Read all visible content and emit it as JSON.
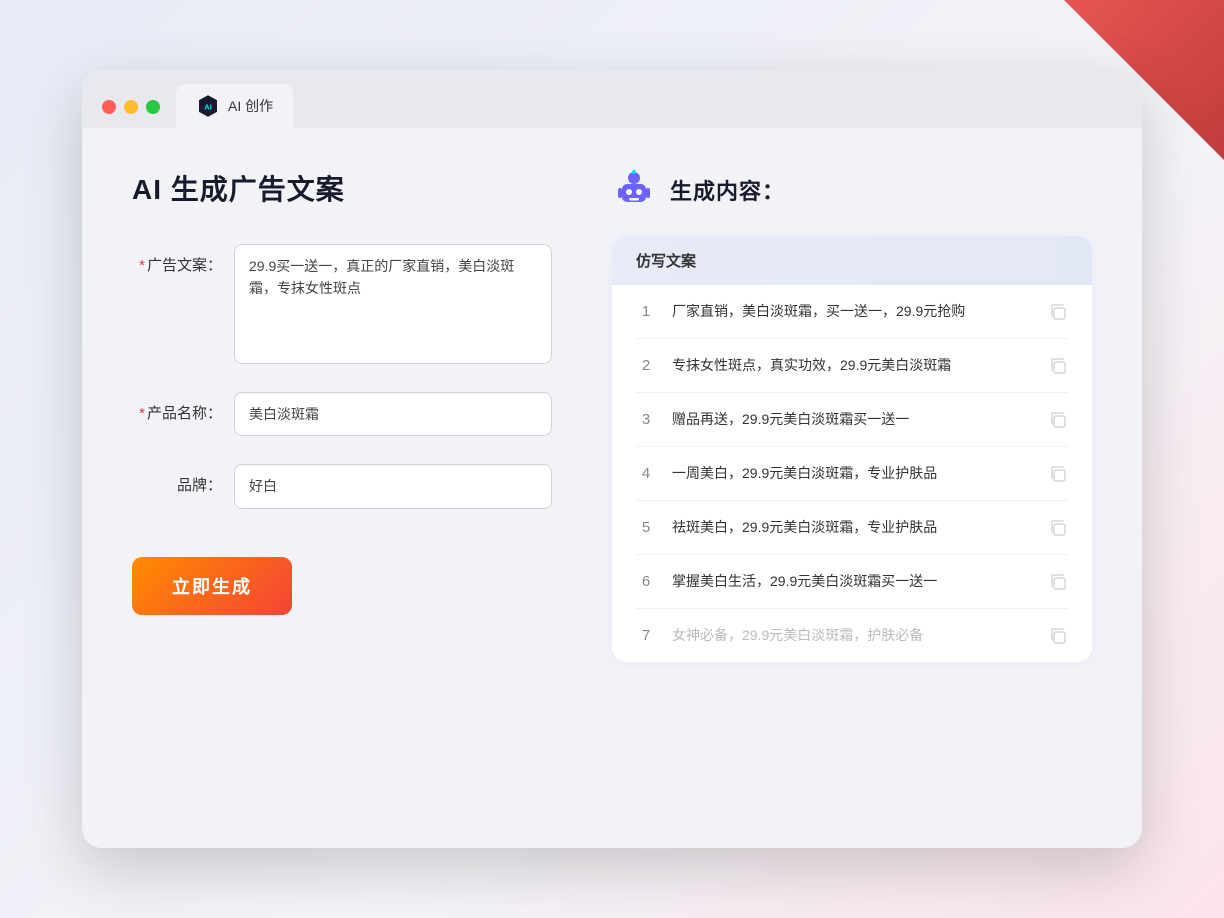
{
  "window": {
    "tab_label": "AI 创作",
    "controls": {
      "close": "close",
      "minimize": "minimize",
      "maximize": "maximize"
    }
  },
  "left_panel": {
    "title": "AI 生成广告文案",
    "form": {
      "ad_copy_label": "广告文案：",
      "ad_copy_required": "*",
      "ad_copy_value": "29.9买一送一，真正的厂家直销，美白淡斑霜，专抹女性斑点",
      "product_name_label": "产品名称：",
      "product_name_required": "*",
      "product_name_value": "美白淡斑霜",
      "brand_label": "品牌：",
      "brand_value": "好白"
    },
    "generate_button": "立即生成"
  },
  "right_panel": {
    "title": "生成内容：",
    "table_header": "仿写文案",
    "results": [
      {
        "num": "1",
        "text": "厂家直销，美白淡斑霜，买一送一，29.9元抢购",
        "dimmed": false
      },
      {
        "num": "2",
        "text": "专抹女性斑点，真实功效，29.9元美白淡斑霜",
        "dimmed": false
      },
      {
        "num": "3",
        "text": "赠品再送，29.9元美白淡斑霜买一送一",
        "dimmed": false
      },
      {
        "num": "4",
        "text": "一周美白，29.9元美白淡斑霜，专业护肤品",
        "dimmed": false
      },
      {
        "num": "5",
        "text": "祛斑美白，29.9元美白淡斑霜，专业护肤品",
        "dimmed": false
      },
      {
        "num": "6",
        "text": "掌握美白生活，29.9元美白淡斑霜买一送一",
        "dimmed": false
      },
      {
        "num": "7",
        "text": "女神必备，29.9元美白淡斑霜，护肤必备",
        "dimmed": true
      }
    ]
  },
  "colors": {
    "accent": "#ff7a2f",
    "primary": "#6c63ff",
    "danger": "#e53935"
  }
}
